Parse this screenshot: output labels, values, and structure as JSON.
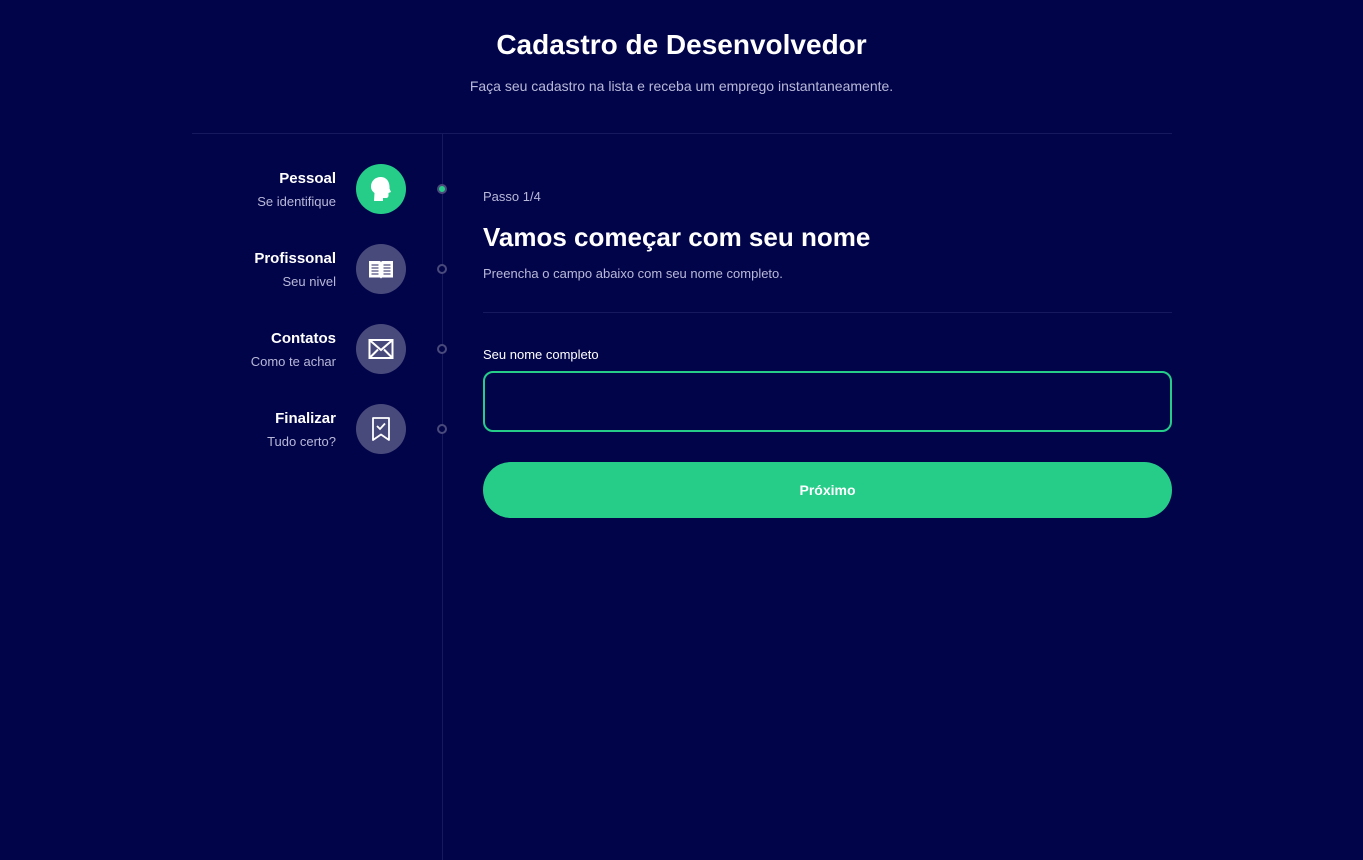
{
  "header": {
    "title": "Cadastro de Desenvolvedor",
    "subtitle": "Faça seu cadastro na lista e receba um emprego instantaneamente."
  },
  "steps": [
    {
      "title": "Pessoal",
      "subtitle": "Se identifique",
      "icon": "head-icon",
      "active": true
    },
    {
      "title": "Profissonal",
      "subtitle": "Seu nivel",
      "icon": "book-icon",
      "active": false
    },
    {
      "title": "Contatos",
      "subtitle": "Como te achar",
      "icon": "mail-icon",
      "active": false
    },
    {
      "title": "Finalizar",
      "subtitle": "Tudo certo?",
      "icon": "bookmark-check-icon",
      "active": false
    }
  ],
  "form": {
    "step_count": "Passo 1/4",
    "title": "Vamos começar com seu nome",
    "description": "Preencha o campo abaixo com seu nome completo.",
    "field_label": "Seu nome completo",
    "field_value": "",
    "button_label": "Próximo"
  },
  "colors": {
    "background": "#02044a",
    "accent": "#25cd89",
    "inactive_circle": "#494a7c",
    "muted_text": "#b8b9d8"
  }
}
